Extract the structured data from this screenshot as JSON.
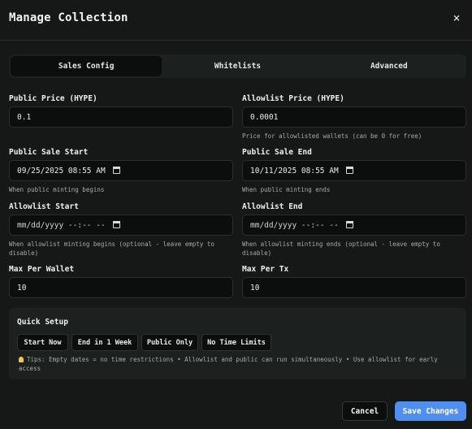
{
  "modal": {
    "title": "Manage Collection",
    "close_label": "×"
  },
  "tabs": [
    {
      "label": "Sales Config",
      "active": true
    },
    {
      "label": "Whitelists",
      "active": false
    },
    {
      "label": "Advanced",
      "active": false
    }
  ],
  "fields": {
    "public_price": {
      "label": "Public Price (HYPE)",
      "value": "0.1"
    },
    "allowlist_price": {
      "label": "Allowlist Price (HYPE)",
      "value": "0.0001",
      "help": "Price for allowlisted wallets (can be 0 for free)"
    },
    "public_sale_start": {
      "label": "Public Sale Start",
      "value": "09/25/2025 08:55 AM",
      "help": "When public minting begins"
    },
    "public_sale_end": {
      "label": "Public Sale End",
      "value": "10/11/2025 08:55 AM",
      "help": "When public minting ends"
    },
    "allowlist_start": {
      "label": "Allowlist Start",
      "placeholder": "mm/dd/yyyy --:-- --",
      "help": "When allowlist minting begins (optional - leave empty to disable)"
    },
    "allowlist_end": {
      "label": "Allowlist End",
      "placeholder": "mm/dd/yyyy --:-- --",
      "help": "When allowlist minting ends (optional - leave empty to disable)"
    },
    "max_per_wallet": {
      "label": "Max Per Wallet",
      "value": "10"
    },
    "max_per_tx": {
      "label": "Max Per Tx",
      "value": "10"
    }
  },
  "quick_setup": {
    "title": "Quick Setup",
    "buttons": [
      "Start Now",
      "End in 1 Week",
      "Public Only",
      "No Time Limits"
    ],
    "tips": "Tips: Empty dates = no time restrictions • Allowlist and public can run simultaneously • Use allowlist for early access"
  },
  "footer": {
    "cancel_label": "Cancel",
    "save_label": "Save Changes"
  },
  "colors": {
    "accent": "#4f8ff0",
    "background": "#151817",
    "input_background": "#0c0e0d",
    "tip_icon": "#f3c64a"
  },
  "icons": {
    "close": "close-icon",
    "calendar": "calendar-icon",
    "tip": "lightbulb-icon"
  }
}
